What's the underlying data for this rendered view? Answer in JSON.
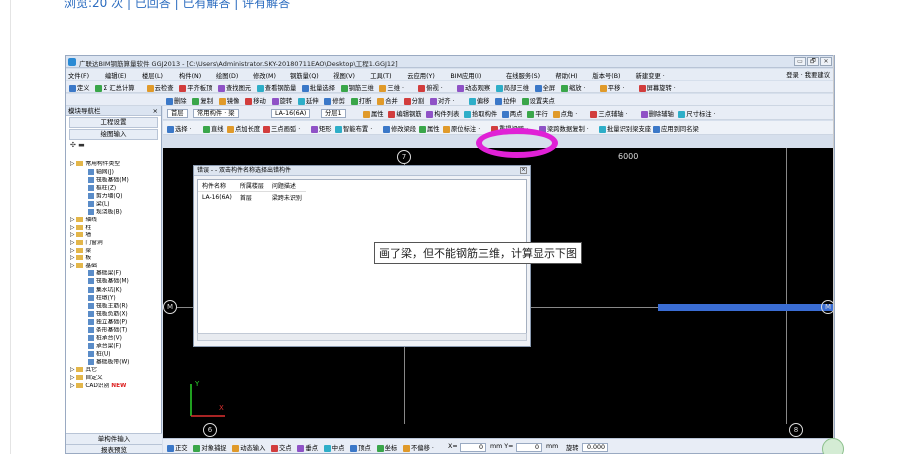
{
  "top_text": "浏览:20 次 | 已回答 | 已有解答 | 评有解答",
  "window": {
    "title": "广联达BIM钢筋算量软件 GGJ2013 - [C:\\Users\\Administrator.SKY-20180711EAO\\Desktop\\工程1.GGJ12]",
    "buttons": [
      "▭",
      "🗗",
      "✕"
    ]
  },
  "menu": {
    "items": [
      "文件(F)",
      "编辑(E)",
      "楼层(L)",
      "构件(N)",
      "绘图(D)",
      "修改(M)",
      "钢筋量(Q)",
      "视图(V)",
      "工具(T)",
      "云应用(Y)",
      "BIM应用(I)",
      "在线服务(S)",
      "帮助(H)",
      "版本号(B)",
      "新建变更 ·"
    ],
    "login": "登录 · 我要建议"
  },
  "toolbar1": {
    "items": [
      "定义",
      "Σ 汇总计算",
      "云检查",
      "平齐板顶",
      "查找图元",
      "查看钢筋量",
      "批量选择",
      "钢筋三维",
      "三维 ·",
      "俯视 ·",
      "动态观察",
      "局部三维",
      "全屏",
      "缩放 ·",
      "平移 ·",
      "屏幕旋转 ·"
    ]
  },
  "toolbar2": {
    "items": [
      "删除",
      "复制",
      "镜像",
      "移动",
      "旋转",
      "延伸",
      "修剪",
      "打断",
      "合并",
      "分割",
      "对齐 ·",
      "偏移",
      "拉伸",
      "设置夹点"
    ]
  },
  "layerbar": {
    "floor": "首层",
    "type": "常用构件 · 梁",
    "component": "LA-16(6A)",
    "layer": "分层1",
    "items": [
      "属性",
      "编辑钢筋",
      "构件列表",
      "拾取构件",
      "两点",
      "平行",
      "点角 ·",
      "三点辅轴 ·",
      "删除辅轴",
      "尺寸标注 ·"
    ]
  },
  "drawbar": {
    "items": [
      "选择 ·",
      "直线",
      "点加长度",
      "三点画弧 ·",
      "矩形",
      "智能布置 ·",
      "修改梁段",
      "属性",
      "原位标注 ·",
      "重提梁跨 ·",
      "梁跨数据复制 ·",
      "批量识别梁支座",
      "应用到同名梁"
    ]
  },
  "nav": {
    "title": "模块导航栏",
    "buttons": [
      "工程设置",
      "绘图输入"
    ],
    "tree": [
      {
        "label": "常用构件类型",
        "level": 0,
        "kind": "folder"
      },
      {
        "label": "轴网(J)",
        "level": 2,
        "kind": "item"
      },
      {
        "label": "筏板基础(M)",
        "level": 2,
        "kind": "item"
      },
      {
        "label": "框柱(Z)",
        "level": 2,
        "kind": "item"
      },
      {
        "label": "剪力墙(Q)",
        "level": 2,
        "kind": "item"
      },
      {
        "label": "梁(L)",
        "level": 2,
        "kind": "item"
      },
      {
        "label": "现浇板(B)",
        "level": 2,
        "kind": "item"
      },
      {
        "label": "轴线",
        "level": 0,
        "kind": "folder"
      },
      {
        "label": "柱",
        "level": 0,
        "kind": "folder"
      },
      {
        "label": "墙",
        "level": 0,
        "kind": "folder"
      },
      {
        "label": "门窗洞",
        "level": 0,
        "kind": "folder"
      },
      {
        "label": "梁",
        "level": 0,
        "kind": "folder"
      },
      {
        "label": "板",
        "level": 0,
        "kind": "folder"
      },
      {
        "label": "基础",
        "level": 0,
        "kind": "folder"
      },
      {
        "label": "基础梁(F)",
        "level": 2,
        "kind": "item"
      },
      {
        "label": "筏板基础(M)",
        "level": 2,
        "kind": "item"
      },
      {
        "label": "集水坑(K)",
        "level": 2,
        "kind": "item"
      },
      {
        "label": "柱墩(Y)",
        "level": 2,
        "kind": "item"
      },
      {
        "label": "筏板主筋(R)",
        "level": 2,
        "kind": "item"
      },
      {
        "label": "筏板负筋(X)",
        "level": 2,
        "kind": "item"
      },
      {
        "label": "独立基础(P)",
        "level": 2,
        "kind": "item"
      },
      {
        "label": "条形基础(T)",
        "level": 2,
        "kind": "item"
      },
      {
        "label": "桩承台(V)",
        "level": 2,
        "kind": "item"
      },
      {
        "label": "承台梁(F)",
        "level": 2,
        "kind": "item"
      },
      {
        "label": "桩(U)",
        "level": 2,
        "kind": "item"
      },
      {
        "label": "基础板带(W)",
        "level": 2,
        "kind": "item"
      },
      {
        "label": "其它",
        "level": 0,
        "kind": "folder"
      },
      {
        "label": "自定义",
        "level": 0,
        "kind": "folder"
      },
      {
        "label": "CAD识别",
        "level": 0,
        "kind": "folder",
        "badge": "NEW"
      }
    ],
    "bottom": [
      "单构件输入",
      "报表预览"
    ]
  },
  "canvas": {
    "axis_top": "7",
    "axis_left": "M",
    "axis_right": "M",
    "axis_bottom_left": "6",
    "axis_bottom_right": "8",
    "dimension": "6000",
    "ucs_x": "X",
    "ucs_y": "Y"
  },
  "dialog": {
    "title": "错误 - - 双击构件名称选择出错构件",
    "columns": [
      "构件名称",
      "所属楼层",
      "问题描述"
    ],
    "rows": [
      [
        "LA-16(6A)",
        "首层",
        "梁跨未识别"
      ]
    ]
  },
  "annotation": "画了梁，但不能钢筋三维，计算显示下图",
  "status": {
    "items": [
      "正交",
      "对象捕捉",
      "动态输入",
      "交点",
      "垂点",
      "中点",
      "顶点",
      "坐标",
      "不偏移 ·"
    ],
    "x_label": "X=",
    "x_value": "0",
    "y_label": "mm Y=",
    "y_value": "0",
    "mm": "mm",
    "rotate": "旋转",
    "rotate_value": "0.000"
  },
  "colors": {
    "highlight_ring": "#e021d6",
    "beam": "#3a6dd4",
    "canvas": "#000000"
  }
}
